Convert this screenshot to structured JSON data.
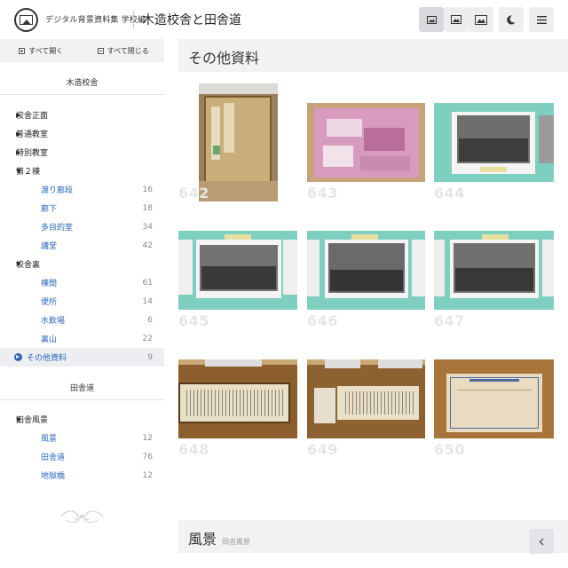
{
  "header": {
    "site_name": "デジタル背景資料集 学校編",
    "page_title": "木造校舎と田舎道",
    "buttons": [
      {
        "name": "view-small-button",
        "icon": "image-small-icon",
        "active": true
      },
      {
        "name": "view-medium-button",
        "icon": "image-medium-icon",
        "active": false
      },
      {
        "name": "view-large-button",
        "icon": "image-large-icon",
        "active": false
      },
      {
        "name": "dark-mode-button",
        "icon": "moon-icon",
        "active": false
      },
      {
        "name": "menu-button",
        "icon": "hamburger-icon",
        "active": false
      }
    ]
  },
  "sidebar": {
    "expand_all": "すべて開く",
    "collapse_all": "すべて閉じる",
    "sections": [
      {
        "title": "木造校舎",
        "items": [
          {
            "label": "校舎正面",
            "arrow": "▶",
            "child": false
          },
          {
            "label": "普通教室",
            "arrow": "▶",
            "child": false
          },
          {
            "label": "特別教室",
            "arrow": "▶",
            "child": false
          },
          {
            "label": "第２棟",
            "arrow": "▼",
            "child": false
          },
          {
            "label": "渡り廊段",
            "count": "16",
            "child": true
          },
          {
            "label": "廊下",
            "count": "18",
            "child": true
          },
          {
            "label": "多目的室",
            "count": "34",
            "child": true
          },
          {
            "label": "講堂",
            "count": "42",
            "child": true
          },
          {
            "label": "校舎裏",
            "arrow": "▼",
            "child": false
          },
          {
            "label": "棟間",
            "count": "61",
            "child": true
          },
          {
            "label": "便所",
            "count": "14",
            "child": true
          },
          {
            "label": "水飲場",
            "count": "6",
            "child": true
          },
          {
            "label": "裏山",
            "count": "22",
            "child": true
          },
          {
            "label": "その他資料",
            "count": "9",
            "child": false,
            "selected": true
          }
        ]
      },
      {
        "title": "田舎道",
        "items": [
          {
            "label": "田舎風景",
            "arrow": "▼",
            "child": false
          },
          {
            "label": "風景",
            "count": "12",
            "child": true
          },
          {
            "label": "田舎道",
            "count": "76",
            "child": true
          },
          {
            "label": "地獄橋",
            "count": "12",
            "child": true
          }
        ]
      }
    ]
  },
  "main": {
    "section1": {
      "title": "その他資料"
    },
    "thumbs": [
      {
        "num": "642",
        "kind": "board"
      },
      {
        "num": "643",
        "kind": "aerial"
      },
      {
        "num": "644",
        "kind": "group"
      },
      {
        "num": "645",
        "kind": "group"
      },
      {
        "num": "646",
        "kind": "group"
      },
      {
        "num": "647",
        "kind": "group"
      },
      {
        "num": "648",
        "kind": "scroll"
      },
      {
        "num": "649",
        "kind": "scroll"
      },
      {
        "num": "650",
        "kind": "plan"
      }
    ],
    "section2": {
      "title": "風景",
      "subtitle": "田舎風景"
    }
  },
  "colors": {
    "accent": "#2a66b8",
    "bar": "#f1f2f4",
    "teal_wall": "#7fcfc1",
    "wood": "#8b5e2b"
  }
}
